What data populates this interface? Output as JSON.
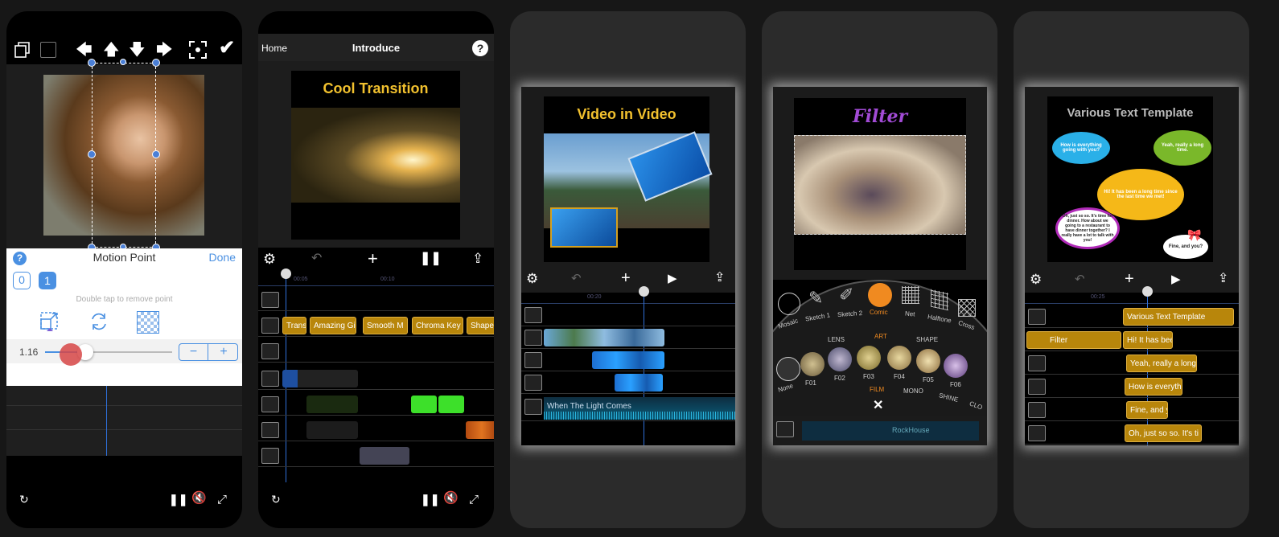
{
  "phone1": {
    "panel_title": "Motion Point",
    "done": "Done",
    "help": "?",
    "point0": "0",
    "point1": "1",
    "hint": "Double tap to remove point",
    "scale_value": "1.16",
    "minus": "−",
    "plus": "+"
  },
  "phone2": {
    "home": "Home",
    "title": "Introduce",
    "help": "?",
    "preview_title": "Cool Transition",
    "ruler": [
      "00:05",
      "00:10"
    ],
    "clips": [
      "Trans",
      "Amazing Gi",
      "Smooth M",
      "Chroma Key",
      "Shape"
    ]
  },
  "phone3": {
    "preview_title": "Video in Video",
    "audio_track": "When The Light Comes",
    "ruler": [
      "00:20"
    ]
  },
  "phone4": {
    "preview_title": "Filter",
    "categories": [
      "Mosaic",
      "Sketch 1",
      "Sketch 2",
      "Comic",
      "Net",
      "Halftone",
      "Cross"
    ],
    "groups": [
      "LENS",
      "ART",
      "SHAPE"
    ],
    "filters": [
      "None",
      "F01",
      "F02",
      "F03",
      "F04",
      "F05",
      "F06"
    ],
    "groups2": [
      "FILM",
      "MONO",
      "SHINE",
      "CLO"
    ],
    "close": "✕",
    "audio_clip": "RockHouse"
  },
  "phone5": {
    "preview_title": "Various Text Template",
    "bubbles": [
      "How is everything going with you?",
      "Yeah, really a long time.",
      "Hi! It has been a long time since the last time we met!",
      "Oh, just so so. It's time for dinner. How about we going to a restaurant to have dinner together? I really have a lot to talk with you!",
      "Fine, and you?"
    ],
    "ruler": [
      "00:25"
    ],
    "clips": [
      "Various Text Template",
      "Filter",
      "Hi! It has bee",
      "Yeah, really a long",
      "How is everythi",
      "Fine, and y",
      "Oh, just so so. It's ti"
    ]
  },
  "colors": {
    "accent_blue": "#4a90e2",
    "gold": "#b8860b",
    "title_yellow": "#f2c12e",
    "filter_purple": "#a24bd6"
  }
}
